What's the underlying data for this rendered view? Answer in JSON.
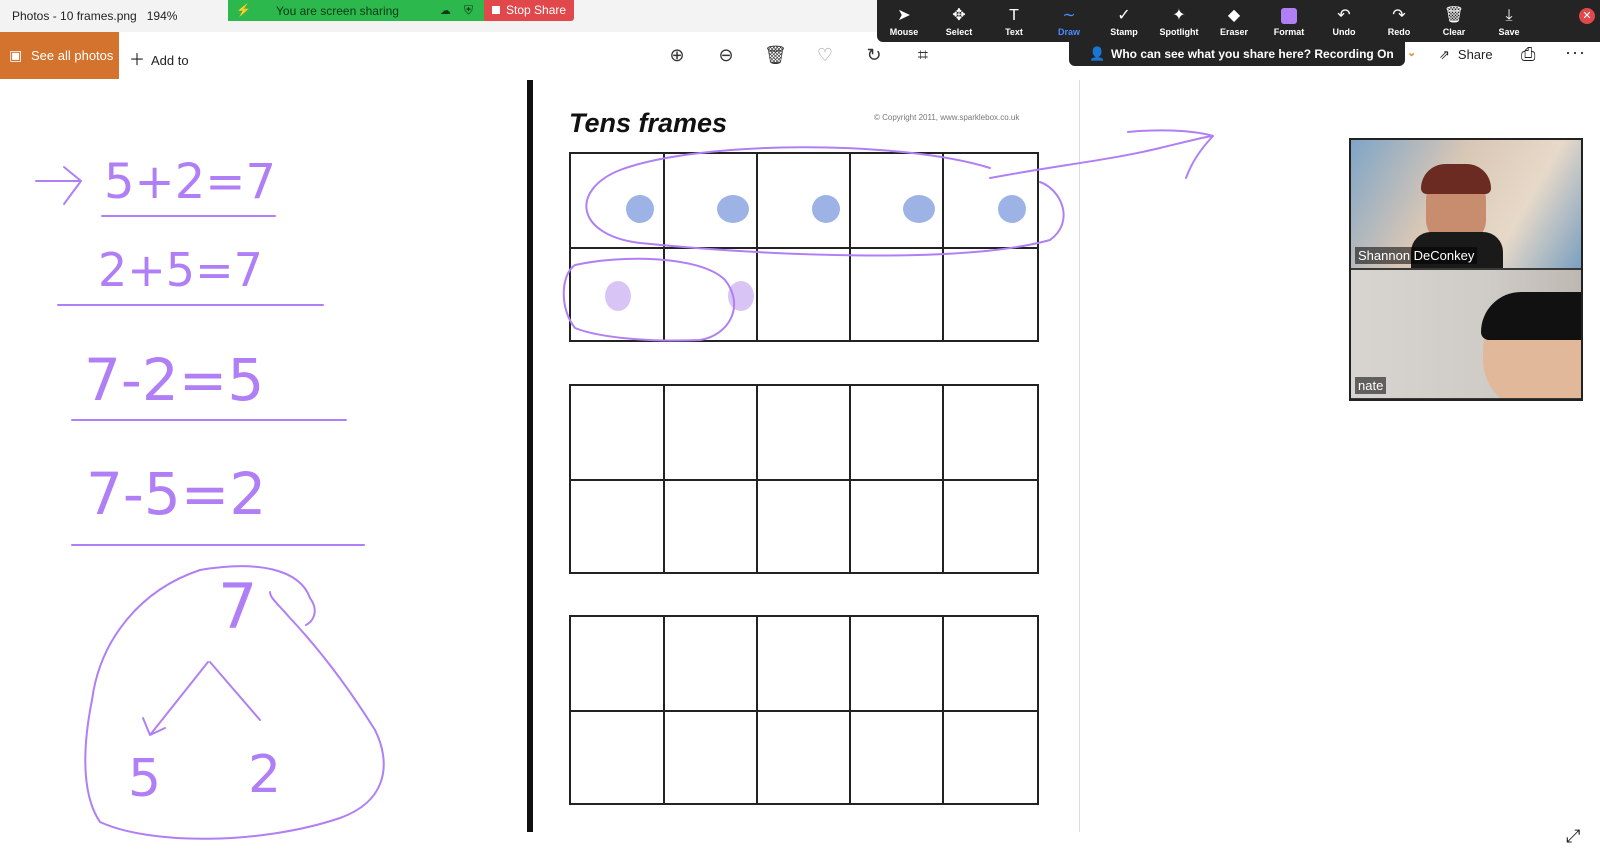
{
  "window": {
    "title": "Photos - 10 frames.png",
    "zoom": "194%"
  },
  "share_banner": {
    "label": "You are screen sharing",
    "stop_label": "Stop Share"
  },
  "toolbar": {
    "tools": [
      {
        "label": "Mouse",
        "icon": "cursor-icon",
        "glyph": "➤"
      },
      {
        "label": "Select",
        "icon": "move-icon",
        "glyph": "✥"
      },
      {
        "label": "Text",
        "icon": "text-icon",
        "glyph": "T"
      },
      {
        "label": "Draw",
        "icon": "draw-icon",
        "glyph": "∼"
      },
      {
        "label": "Stamp",
        "icon": "check-icon",
        "glyph": "✓"
      },
      {
        "label": "Spotlight",
        "icon": "spotlight-icon",
        "glyph": "✦"
      },
      {
        "label": "Eraser",
        "icon": "eraser-icon",
        "glyph": "◆"
      },
      {
        "label": "Format",
        "icon": "format-swatch-icon",
        "glyph": ""
      },
      {
        "label": "Undo",
        "icon": "undo-icon",
        "glyph": "↶"
      },
      {
        "label": "Redo",
        "icon": "redo-icon",
        "glyph": "↷"
      },
      {
        "label": "Clear",
        "icon": "trash-icon",
        "glyph": "🗑"
      },
      {
        "label": "Save",
        "icon": "save-icon",
        "glyph": "⤓"
      }
    ],
    "active": "Draw",
    "format_color": "#b07ff5"
  },
  "viewer_banner": {
    "label": "Who can see what you share here? Recording On"
  },
  "appbar": {
    "see_all": "See all photos",
    "add_to": "Add to",
    "share": "Share",
    "accent": "#d3732d"
  },
  "document": {
    "title": "Tens frames",
    "copyright": "© Copyright 2011, www.sparklebox.co.uk"
  },
  "annotations": {
    "ink_color": "#b07ff5",
    "equations": [
      "5+2=7",
      "2+5=7",
      "7-2=5",
      "7-5=2"
    ],
    "triangle": {
      "top": "7",
      "left": "5",
      "right": "2"
    },
    "counters_blue": 5,
    "counters_purple": 2,
    "blue": "#9db3e6",
    "purple": "#d9c5f5"
  },
  "participants": [
    {
      "name": "Shannon DeConkey"
    },
    {
      "name": "nate"
    }
  ]
}
